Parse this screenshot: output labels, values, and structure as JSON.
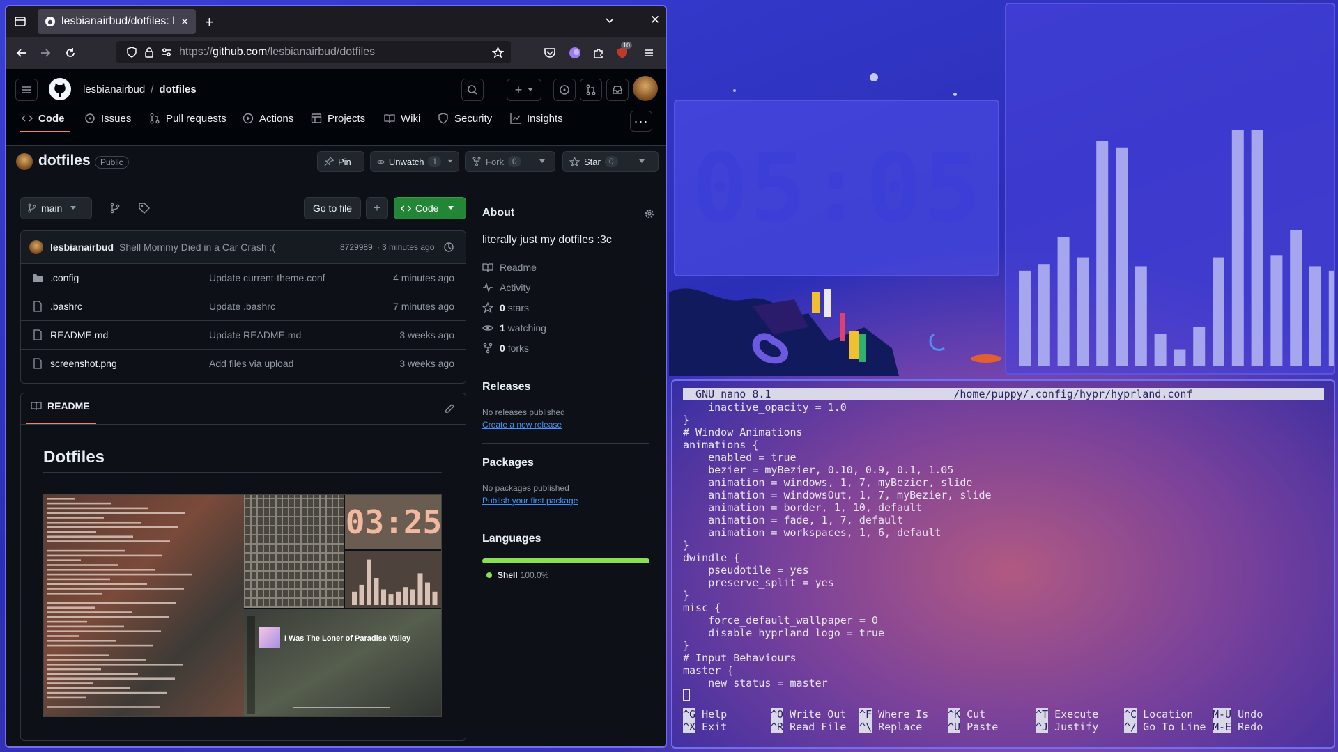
{
  "browser": {
    "tab_title": "lesbianairbud/dotfiles: lite",
    "url_prefix": "https://",
    "url_host": "github.com",
    "url_path": "/lesbianairbud/dotfiles",
    "ext_badge": "10"
  },
  "github": {
    "owner": "lesbianairbud",
    "slash": "/",
    "repo": "dotfiles",
    "tabs": [
      "Code",
      "Issues",
      "Pull requests",
      "Actions",
      "Projects",
      "Wiki",
      "Security",
      "Insights"
    ],
    "repo_title": "dotfiles",
    "visibility": "Public",
    "pin": "Pin",
    "unwatch": "Unwatch",
    "watch_count": "1",
    "fork": "Fork",
    "fork_count": "0",
    "star": "Star",
    "star_count": "0",
    "branch": "main",
    "go_to_file": "Go to file",
    "code_btn": "Code",
    "commit": {
      "author": "lesbianairbud",
      "message": "Shell Mommy Died in a Car Crash :(",
      "hash": "8729989",
      "dot": "·",
      "time": "3 minutes ago"
    },
    "files": [
      {
        "name": ".config",
        "message": "Update current-theme.conf",
        "time": "4 minutes ago",
        "kind": "folder"
      },
      {
        "name": ".bashrc",
        "message": "Update .bashrc",
        "time": "7 minutes ago",
        "kind": "file"
      },
      {
        "name": "README.md",
        "message": "Update README.md",
        "time": "3 weeks ago",
        "kind": "file"
      },
      {
        "name": "screenshot.png",
        "message": "Add files via upload",
        "time": "3 weeks ago",
        "kind": "file"
      }
    ],
    "readme_tab": "README",
    "readme_heading": "Dotfiles",
    "shot_clock": "03:25",
    "shot_song": "I Was The Loner of Paradise Valley",
    "about": {
      "title": "About",
      "desc": "literally just my dotfiles :3c",
      "readme": "Readme",
      "activity": "Activity",
      "stars_n": "0",
      "stars": "stars",
      "watching_n": "1",
      "watching": "watching",
      "forks_n": "0",
      "forks": "forks"
    },
    "releases": {
      "title": "Releases",
      "none": "No releases published",
      "link": "Create a new release"
    },
    "packages": {
      "title": "Packages",
      "none": "No packages published",
      "link": "Publish your first package"
    },
    "languages": {
      "title": "Languages",
      "name": "Shell",
      "pct": "100.0%",
      "color": "#89e051"
    }
  },
  "clock": "05:05",
  "visualizer_levels": [
    0.37,
    0.4,
    0.52,
    0.43,
    0.95,
    0.92,
    0.39,
    0.09,
    0.02,
    0.12,
    0.43,
    1.0,
    1.0,
    0.44,
    0.55,
    0.39,
    0.37
  ],
  "nano": {
    "title": "  GNU nano 8.1                             /home/puppy/.config/hypr/hyprland.conf",
    "lines": [
      "    inactive_opacity = 1.0",
      "}",
      "# Window Animations",
      "animations {",
      "    enabled = true",
      "    bezier = myBezier, 0.10, 0.9, 0.1, 1.05",
      "    animation = windows, 1, 7, myBezier, slide",
      "    animation = windowsOut, 1, 7, myBezier, slide",
      "    animation = border, 1, 10, default",
      "    animation = fade, 1, 7, default",
      "    animation = workspaces, 1, 6, default",
      "}",
      "dwindle {",
      "    pseudotile = yes",
      "    preserve_split = yes",
      "}",
      "misc {",
      "    force_default_wallpaper = 0",
      "    disable_hyprland_logo = true",
      "}",
      "# Input Behaviours",
      "master {",
      "    new_status = master"
    ],
    "shortcuts": [
      {
        "k1": "^G",
        "l1": "Help",
        "k2": "^X",
        "l2": "Exit"
      },
      {
        "k1": "^O",
        "l1": "Write Out",
        "k2": "^R",
        "l2": "Read File"
      },
      {
        "k1": "^F",
        "l1": "Where Is",
        "k2": "^\\",
        "l2": "Replace"
      },
      {
        "k1": "^K",
        "l1": "Cut",
        "k2": "^U",
        "l2": "Paste"
      },
      {
        "k1": "^T",
        "l1": "Execute",
        "k2": "^J",
        "l2": "Justify"
      },
      {
        "k1": "^C",
        "l1": "Location",
        "k2": "^/",
        "l2": "Go To Line"
      },
      {
        "k1": "M-U",
        "l1": "Undo",
        "k2": "M-E",
        "l2": "Redo"
      }
    ]
  }
}
